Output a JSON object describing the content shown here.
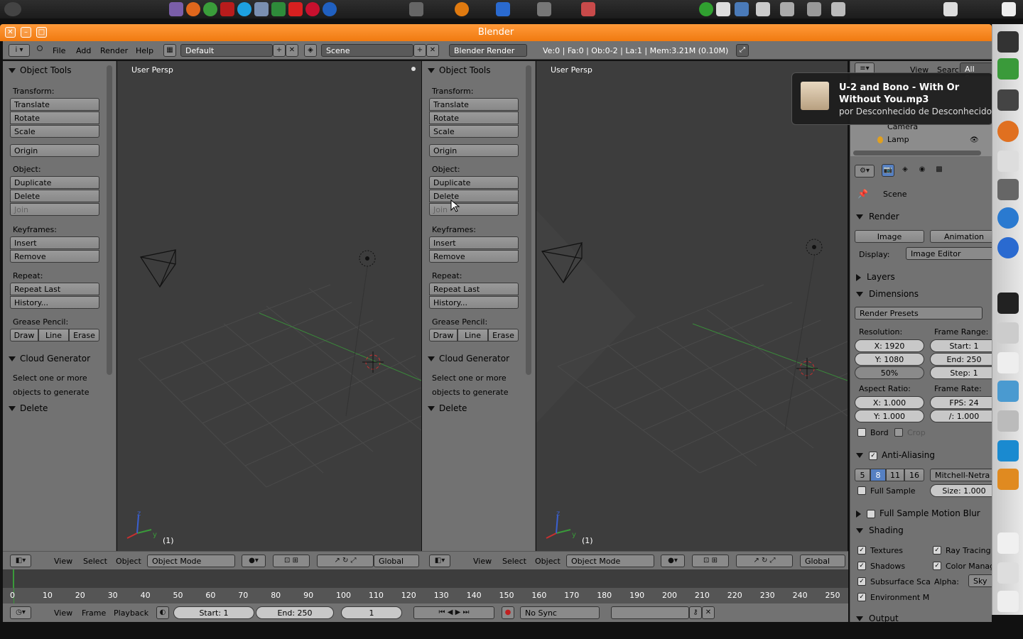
{
  "window": {
    "title": "Blender"
  },
  "header": {
    "menus": [
      "File",
      "Add",
      "Render",
      "Help"
    ],
    "screen_layout": "Default",
    "scene": "Scene",
    "render_engine": "Blender Render",
    "stats": "Ve:0 | Fa:0 | Ob:0-2 | La:1 | Mem:3.21M (0.10M)"
  },
  "tool_shelf": {
    "title": "Object Tools",
    "transform_label": "Transform:",
    "translate": "Translate",
    "rotate": "Rotate",
    "scale": "Scale",
    "origin": "Origin",
    "object_label": "Object:",
    "duplicate": "Duplicate",
    "delete": "Delete",
    "join": "Join",
    "keyframes_label": "Keyframes:",
    "insert": "Insert",
    "remove": "Remove",
    "repeat_label": "Repeat:",
    "repeat_last": "Repeat Last",
    "history": "History...",
    "grease_label": "Grease Pencil:",
    "draw": "Draw",
    "line": "Line",
    "erase": "Erase",
    "cloud_title": "Cloud Generator",
    "cloud_text1": "Select one or more",
    "cloud_text2": "objects to generate",
    "delete_panel": "Delete"
  },
  "viewport": {
    "label": "User Persp",
    "frame": "(1)",
    "menus": [
      "View",
      "Select",
      "Object"
    ],
    "mode": "Object Mode",
    "orientation": "Global"
  },
  "timeline": {
    "ticks": [
      "0",
      "10",
      "20",
      "30",
      "40",
      "50",
      "60",
      "70",
      "80",
      "90",
      "100",
      "110",
      "120",
      "130",
      "140",
      "150",
      "160",
      "170",
      "180",
      "190",
      "200",
      "210",
      "220",
      "230",
      "240",
      "250"
    ],
    "menus": [
      "View",
      "Frame",
      "Playback"
    ],
    "start": "Start: 1",
    "end": "End: 250",
    "current": "1",
    "sync": "No Sync"
  },
  "outliner": {
    "menus": [
      "View",
      "Search",
      "All Scen"
    ],
    "items": [
      "Camera",
      "Lamp"
    ]
  },
  "properties": {
    "scene": "Scene",
    "render_title": "Render",
    "image_btn": "Image",
    "animation_btn": "Animation",
    "display_label": "Display:",
    "display_value": "Image Editor",
    "layers": "Layers",
    "dimensions": "Dimensions",
    "render_presets": "Render Presets",
    "resolution_label": "Resolution:",
    "res_x": "X: 1920",
    "res_y": "Y: 1080",
    "res_pct": "50%",
    "frame_range_label": "Frame Range:",
    "start": "Start: 1",
    "end": "End: 250",
    "step": "Step: 1",
    "aspect_label": "Aspect Ratio:",
    "aspect_x": "X: 1.000",
    "aspect_y": "Y: 1.000",
    "frame_rate_label": "Frame Rate:",
    "fps": "FPS: 24",
    "fps_base": "/: 1.000",
    "bord": "Bord",
    "crop": "Crop",
    "anti_aliasing": "Anti-Aliasing",
    "aa_samples": [
      "5",
      "8",
      "11",
      "16"
    ],
    "aa_filter": "Mitchell-Netra",
    "full_sample": "Full Sample",
    "size": "Size: 1.000",
    "motion_blur": "Full Sample Motion Blur",
    "shading": "Shading",
    "textures": "Textures",
    "ray_tracing": "Ray Tracing",
    "shadows": "Shadows",
    "color_manage": "Color Manage",
    "subsurface": "Subsurface Sca",
    "alpha_label": "Alpha:",
    "alpha_value": "Sky",
    "environment": "Environment M",
    "output": "Output"
  },
  "notification": {
    "title": "U-2 and Bono - With Or Without You.mp3",
    "subtitle": "por Desconhecido de Desconhecido"
  },
  "colors": {
    "titlebar": "#f07a10",
    "panel": "#727272",
    "viewport": "#3d3d3d",
    "accent": "#5680c2"
  }
}
